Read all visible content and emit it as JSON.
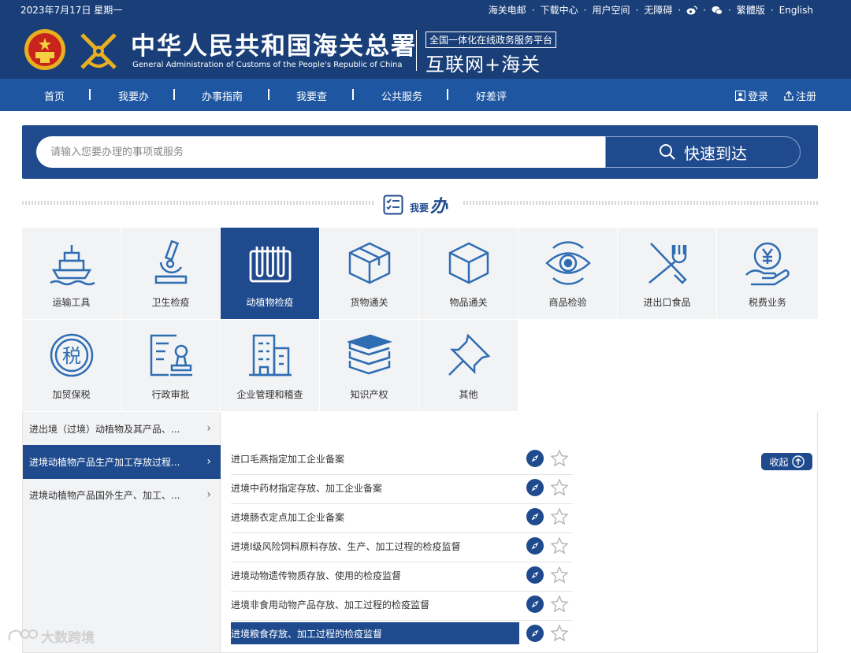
{
  "topbar": {
    "date": "2023年7月17日  星期一",
    "links": [
      "海关电邮",
      "下载中心",
      "用户空间",
      "无障碍",
      "繁體版",
      "English"
    ],
    "separator": "·"
  },
  "brand": {
    "name_cn": "中华人民共和国海关总署",
    "name_en": "General Administration of Customs of the People's Republic of China",
    "platform_box": "全国一体化在线政务服务平台",
    "platform_big": "互联网+海关"
  },
  "nav": {
    "items": [
      "首页",
      "我要办",
      "办事指南",
      "我要查",
      "公共服务",
      "好差评"
    ],
    "login": "登录",
    "register": "注册"
  },
  "search": {
    "placeholder": "请输入您要办理的事项或服务",
    "button": "快速到达"
  },
  "section": {
    "title_small": "我要",
    "title_big": "办"
  },
  "categories": [
    {
      "label": "运输工具",
      "icon": "ship-icon"
    },
    {
      "label": "卫生检疫",
      "icon": "microscope-icon"
    },
    {
      "label": "动植物检疫",
      "icon": "test-tubes-icon",
      "active": true
    },
    {
      "label": "货物通关",
      "icon": "package-icon"
    },
    {
      "label": "物品通关",
      "icon": "cube-icon"
    },
    {
      "label": "商品检验",
      "icon": "eye-icon"
    },
    {
      "label": "进出口食品",
      "icon": "fork-knife-icon"
    },
    {
      "label": "税费业务",
      "icon": "yuan-hand-icon"
    },
    {
      "label": "加贸保税",
      "icon": "tax-circle-icon"
    },
    {
      "label": "行政审批",
      "icon": "stamp-doc-icon"
    },
    {
      "label": "企业管理和稽查",
      "icon": "building-icon"
    },
    {
      "label": "知识产权",
      "icon": "books-icon"
    },
    {
      "label": "其他",
      "icon": "pin-icon"
    }
  ],
  "subcategories": [
    {
      "label": "进出境（过境）动植物及其产品、...",
      "active": false
    },
    {
      "label": "进境动植物产品生产加工存放过程...",
      "active": true
    },
    {
      "label": "进境动植物产品国外生产、加工、...",
      "active": false
    }
  ],
  "collapse_label": "收起",
  "services": [
    {
      "label": "进口毛燕指定加工企业备案",
      "selected": false
    },
    {
      "label": "进境中药材指定存放、加工企业备案",
      "selected": false
    },
    {
      "label": "进境肠衣定点加工企业备案",
      "selected": false
    },
    {
      "label": "进境Ⅰ级风险饲料原料存放、生产、加工过程的检疫监督",
      "selected": false
    },
    {
      "label": "进境动物遗传物质存放、使用的检疫监督",
      "selected": false
    },
    {
      "label": "进境非食用动物产品存放、加工过程的检疫监督",
      "selected": false
    },
    {
      "label": "进境粮食存放、加工过程的检疫监督",
      "selected": true
    }
  ],
  "watermark": "大数跨境",
  "colors": {
    "header_bg": "#1a3f78",
    "nav_bg": "#1f56a1",
    "accent": "#1f4b8e",
    "icon_blue": "#2f6db3",
    "tile_bg": "#f2f3f5"
  }
}
